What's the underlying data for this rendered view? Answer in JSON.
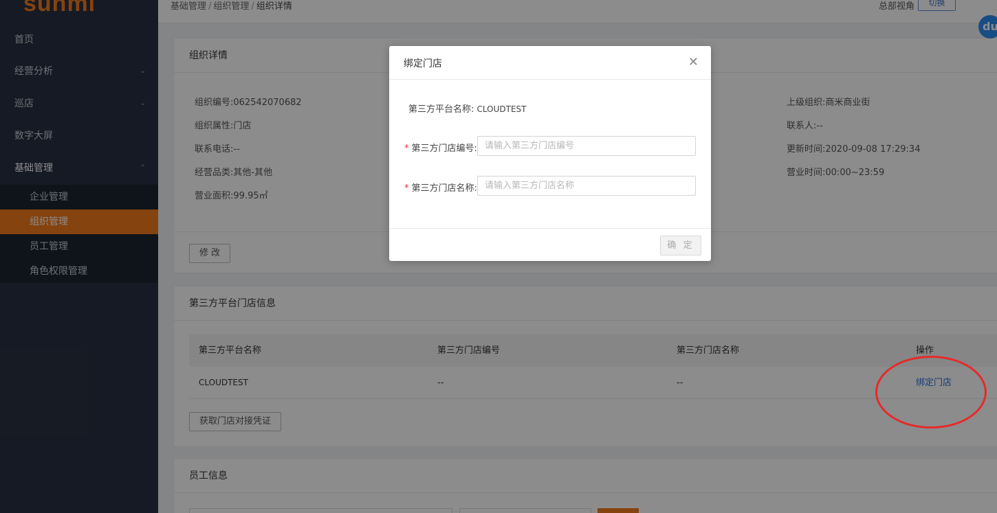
{
  "sidebar": {
    "logo": "sunmi",
    "items": [
      {
        "label": "首页"
      },
      {
        "label": "经营分析"
      },
      {
        "label": "巡店"
      },
      {
        "label": "数字大屏"
      },
      {
        "label": "基础管理"
      }
    ],
    "sub_items": [
      {
        "label": "企业管理"
      },
      {
        "label": "组织管理"
      },
      {
        "label": "员工管理"
      },
      {
        "label": "角色权限管理"
      }
    ]
  },
  "topbar": {
    "breadcrumb": [
      "基础管理",
      "组织管理",
      "组织详情"
    ],
    "separator": "/",
    "view_label": "总部视角",
    "switch_label": "切换",
    "badge": "du"
  },
  "org_detail": {
    "title": "组织详情",
    "fields": [
      {
        "label": "组织编号:",
        "value": "062542070682"
      },
      {
        "label": "组织属性:",
        "value": "门店"
      },
      {
        "label": "联系电话:",
        "value": "--"
      },
      {
        "label": "经营品类:",
        "value": "其他-其他"
      },
      {
        "label": "营业面积:",
        "value": "99.95㎡"
      },
      {
        "label": "上级组织:",
        "value": "商米商业街"
      },
      {
        "label": "联系人:",
        "value": "--"
      },
      {
        "label": "更新时间:",
        "value": "2020-09-08 17:29:34"
      },
      {
        "label": "营业时间:",
        "value": "00:00~23:59"
      }
    ],
    "edit_button": "修 改"
  },
  "third_party": {
    "title": "第三方平台门店信息",
    "columns": [
      "第三方平台名称",
      "第三方门店编号",
      "第三方门店名称",
      "操作"
    ],
    "row": {
      "platform": "CLOUDTEST",
      "store_no": "--",
      "store_name": "--",
      "action": "绑定门店"
    },
    "credential_button": "获取门店对接凭证"
  },
  "staff": {
    "title": "员工信息"
  },
  "modal": {
    "title": "绑定门店",
    "close": "✕",
    "platform_label": "第三方平台名称:",
    "platform_value": "CLOUDTEST",
    "required_mark": "*",
    "store_no_label": "第三方门店编号:",
    "store_no_placeholder": "请输入第三方门店编号",
    "store_name_label": "第三方门店名称:",
    "store_name_placeholder": "请输入第三方门店名称",
    "confirm": "确 定"
  },
  "colors": {
    "brand": "#f07a1d",
    "sidebar": "#283142",
    "link": "#2f6fd6",
    "annotation": "#e52a2a"
  }
}
